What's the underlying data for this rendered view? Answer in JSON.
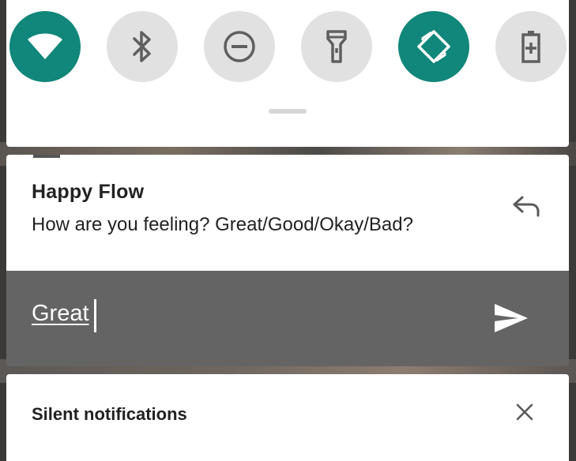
{
  "quick_settings": {
    "tiles": [
      {
        "name": "wifi",
        "icon": "wifi-icon",
        "on": true
      },
      {
        "name": "bluetooth",
        "icon": "bluetooth-icon",
        "on": false
      },
      {
        "name": "do-not-disturb",
        "icon": "do-not-disturb-icon",
        "on": false
      },
      {
        "name": "flashlight",
        "icon": "flashlight-icon",
        "on": false
      },
      {
        "name": "auto-rotate",
        "icon": "auto-rotate-icon",
        "on": true
      },
      {
        "name": "battery-saver",
        "icon": "battery-saver-icon",
        "on": false
      }
    ],
    "active_color": "#11867a",
    "inactive_color": "#e1e1e1"
  },
  "notification": {
    "app_name": "Happy Flow",
    "message": "How are you feeling? Great/Good/Okay/Bad?",
    "action_icon": "reply-icon"
  },
  "reply": {
    "value": "Great",
    "send_icon": "send-icon",
    "bar_color": "#646464"
  },
  "silent_section": {
    "label": "Silent notifications",
    "close_icon": "close-icon"
  }
}
